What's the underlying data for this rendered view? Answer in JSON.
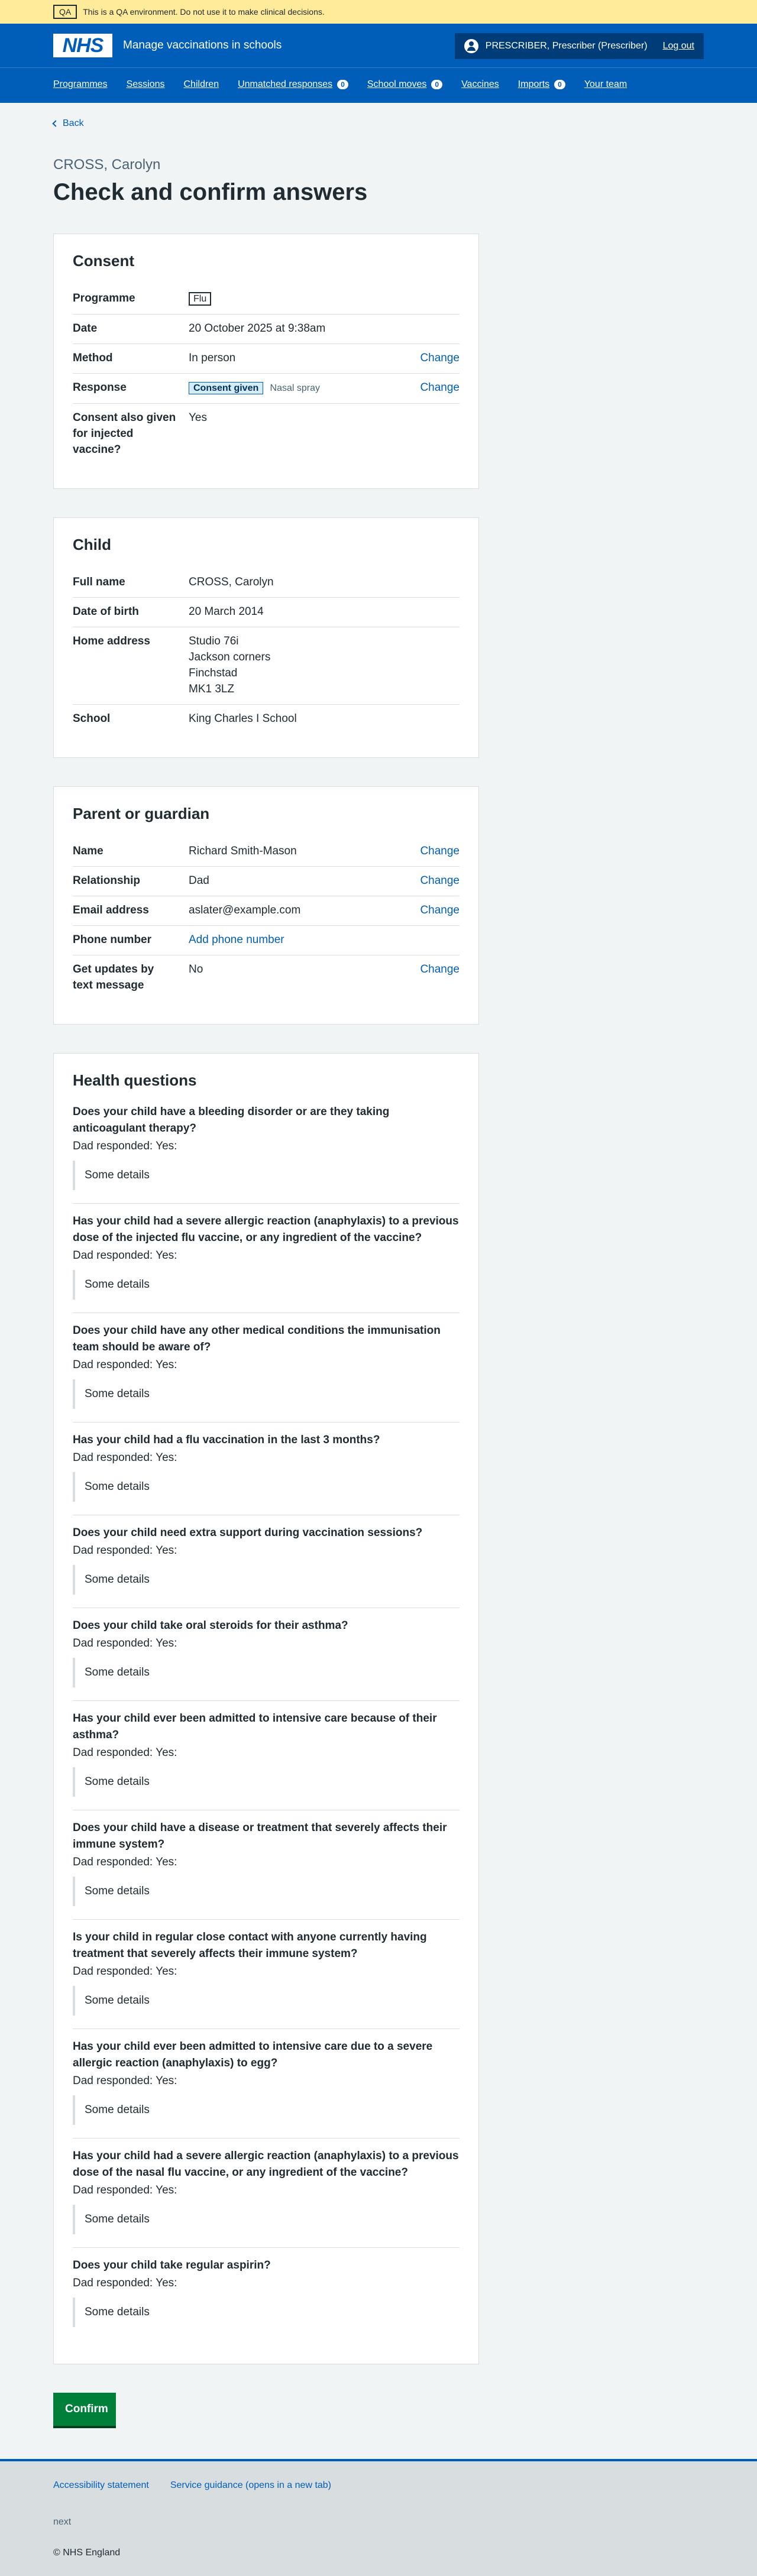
{
  "qa_banner": {
    "tag": "QA",
    "text": "This is a QA environment. Do not use it to make clinical decisions."
  },
  "header": {
    "logo": "NHS",
    "service_name": "Manage vaccinations in schools",
    "account_name": "PRESCRIBER, Prescriber (Prescriber)",
    "logout": "Log out"
  },
  "nav": [
    {
      "label": "Programmes"
    },
    {
      "label": "Sessions"
    },
    {
      "label": "Children"
    },
    {
      "label": "Unmatched responses",
      "count": "0"
    },
    {
      "label": "School moves",
      "count": "0"
    },
    {
      "label": "Vaccines"
    },
    {
      "label": "Imports",
      "count": "0"
    },
    {
      "label": "Your team"
    }
  ],
  "back_link": "Back",
  "caption": "CROSS, Carolyn",
  "title": "Check and confirm answers",
  "consent": {
    "heading": "Consent",
    "programme_key": "Programme",
    "programme_val": "Flu",
    "date_key": "Date",
    "date_val": "20 October 2025 at 9:38am",
    "method_key": "Method",
    "method_val": "In person",
    "response_key": "Response",
    "response_tag": "Consent given",
    "response_sub": "Nasal spray",
    "injected_key": "Consent also given for injected vaccine?",
    "injected_val": "Yes",
    "change": "Change"
  },
  "child": {
    "heading": "Child",
    "name_key": "Full name",
    "name_val": "CROSS, Carolyn",
    "dob_key": "Date of birth",
    "dob_val": "20 March 2014",
    "address_key": "Home address",
    "address": [
      "Studio 76i",
      "Jackson corners",
      "Finchstad",
      "MK1 3LZ"
    ],
    "school_key": "School",
    "school_val": "King Charles I School"
  },
  "parent": {
    "heading": "Parent or guardian",
    "name_key": "Name",
    "name_val": "Richard Smith-Mason",
    "rel_key": "Relationship",
    "rel_val": "Dad",
    "email_key": "Email address",
    "email_val": "aslater@example.com",
    "phone_key": "Phone number",
    "phone_val": "Add phone number",
    "text_key": "Get updates by text message",
    "text_val": "No",
    "change": "Change"
  },
  "health": {
    "heading": "Health questions",
    "response": "Dad responded: Yes:",
    "detail": "Some details",
    "questions": [
      "Does your child have a bleeding disorder or are they taking anticoagulant therapy?",
      "Has your child had a severe allergic reaction (anaphylaxis) to a previous dose of the injected flu vaccine, or any ingredient of the vaccine?",
      "Does your child have any other medical conditions the immunisation team should be aware of?",
      "Has your child had a flu vaccination in the last 3 months?",
      "Does your child need extra support during vaccination sessions?",
      "Does your child take oral steroids for their asthma?",
      "Has your child ever been admitted to intensive care because of their asthma?",
      "Does your child have a disease or treatment that severely affects their immune system?",
      "Is your child in regular close contact with anyone currently having treatment that severely affects their immune system?",
      "Has your child ever been admitted to intensive care due to a severe allergic reaction (anaphylaxis) to egg?",
      "Has your child had a severe allergic reaction (anaphylaxis) to a previous dose of the nasal flu vaccine, or any ingredient of the vaccine?",
      "Does your child take regular aspirin?"
    ]
  },
  "confirm_button": "Confirm",
  "footer": {
    "links": [
      "Accessibility statement",
      "Service guidance (opens in a new tab)"
    ],
    "next": "next",
    "copyright": "© NHS England"
  }
}
